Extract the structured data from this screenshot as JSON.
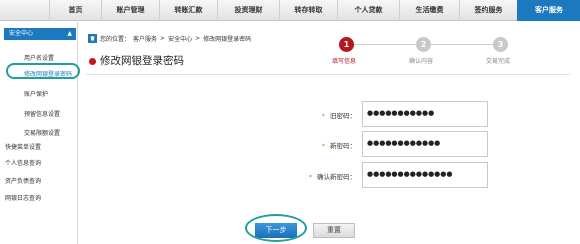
{
  "topnav": {
    "items": [
      "首页",
      "账户管理",
      "转账汇款",
      "投资理财",
      "转存转取",
      "个人贷款",
      "生活缴费",
      "签约服务",
      "客户服务"
    ],
    "active_index": 8
  },
  "sidebar": {
    "section_title": "安全中心",
    "section_arrow": "▲",
    "items": [
      {
        "label": "用户名设置"
      },
      {
        "label": "修改网银登录密码"
      },
      {
        "label": "账户保护"
      },
      {
        "label": "预留信息设置"
      },
      {
        "label": "交易限额设置"
      },
      {
        "label": "快捷菜单设置"
      },
      {
        "label": "个人信息查询"
      },
      {
        "label": "资产负债查询"
      },
      {
        "label": "网银日志查询"
      }
    ],
    "active_item": "修改网银登录密码"
  },
  "breadcrumb": {
    "prefix": "您的位置：",
    "parts": [
      "客户服务",
      "安全中心",
      "修改网银登录密码"
    ],
    "separator": ">"
  },
  "page": {
    "title": "修改网银登录密码"
  },
  "steps": [
    {
      "number": "1",
      "label": "填写信息",
      "active": true
    },
    {
      "number": "2",
      "label": "确认内容",
      "active": false
    },
    {
      "number": "3",
      "label": "交易完成",
      "active": false
    }
  ],
  "form": {
    "fields": [
      {
        "label": "旧密码：",
        "required_mark": "*",
        "value": "●●●●●●●●●●●"
      },
      {
        "label": "新密码：",
        "required_mark": "*",
        "value": "●●●●●●●●●●●●"
      },
      {
        "label": "确认新密码：",
        "required_mark": "*",
        "value": "●●●●●●●●●●●●●●"
      }
    ]
  },
  "buttons": {
    "next": "下一步",
    "reset": "重置"
  },
  "colors": {
    "brand_blue": "#1c79c0",
    "step_active_red": "#b3171f",
    "highlight_teal": "#21a09a",
    "required_orange": "#e3781a"
  }
}
